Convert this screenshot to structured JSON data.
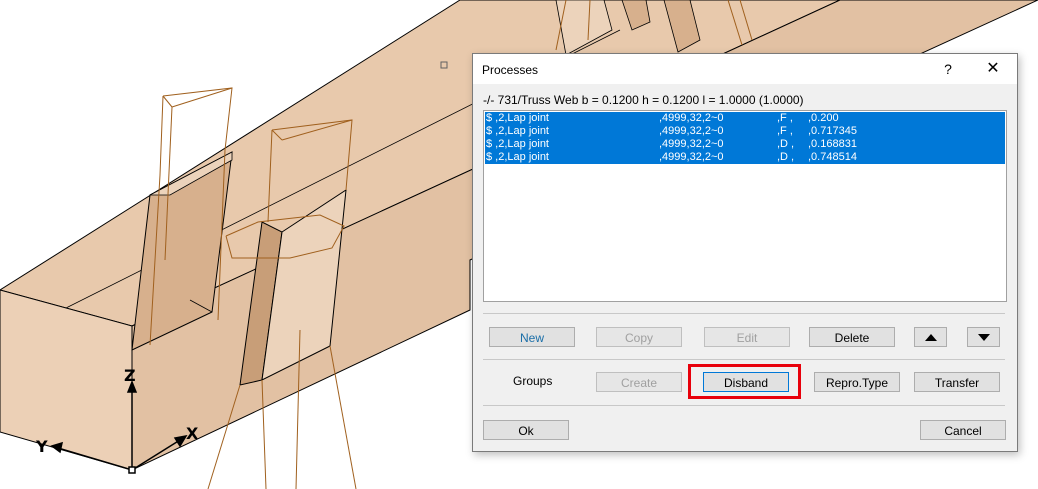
{
  "viewport": {
    "axes": {
      "z": "Z",
      "x": "X",
      "y": "Y"
    },
    "colors": {
      "beam_face": "#e8c9ac",
      "beam_front": "#ecd0b6",
      "beam_edge": "#000000",
      "wire": "#a0601e"
    }
  },
  "dialog": {
    "title": "Processes",
    "help_label": "?",
    "close_label": "✕",
    "info_line": "-/- 731/Truss Web b = 0.1200 h = 0.1200 l = 1.0000 (1.0000)",
    "process_rows": [
      {
        "name": "$ ,2,Lap joint",
        "params": ",4999,32,2~0",
        "side": ",F ,",
        "value": ",0.200"
      },
      {
        "name": "$ ,2,Lap joint",
        "params": ",4999,32,2~0",
        "side": ",F ,",
        "value": ",0.717345"
      },
      {
        "name": "$ ,2,Lap joint",
        "params": ",4999,32,2~0",
        "side": ",D ,",
        "value": ",0.168831"
      },
      {
        "name": "$ ,2,Lap joint",
        "params": ",4999,32,2~0",
        "side": ",D ,",
        "value": ",0.748514"
      }
    ],
    "list_selection_color": "#0078d7",
    "buttons": {
      "new": "New",
      "copy": "Copy",
      "edit": "Edit",
      "delete": "Delete",
      "move_up_icon": "triangle-up-icon",
      "move_down_icon": "triangle-down-icon"
    },
    "groups": {
      "label": "Groups",
      "create": "Create",
      "disband": "Disband",
      "repro_type": "Repro.Type",
      "transfer": "Transfer"
    },
    "ok": "Ok",
    "cancel": "Cancel",
    "highlight_color": "#e8000b"
  }
}
